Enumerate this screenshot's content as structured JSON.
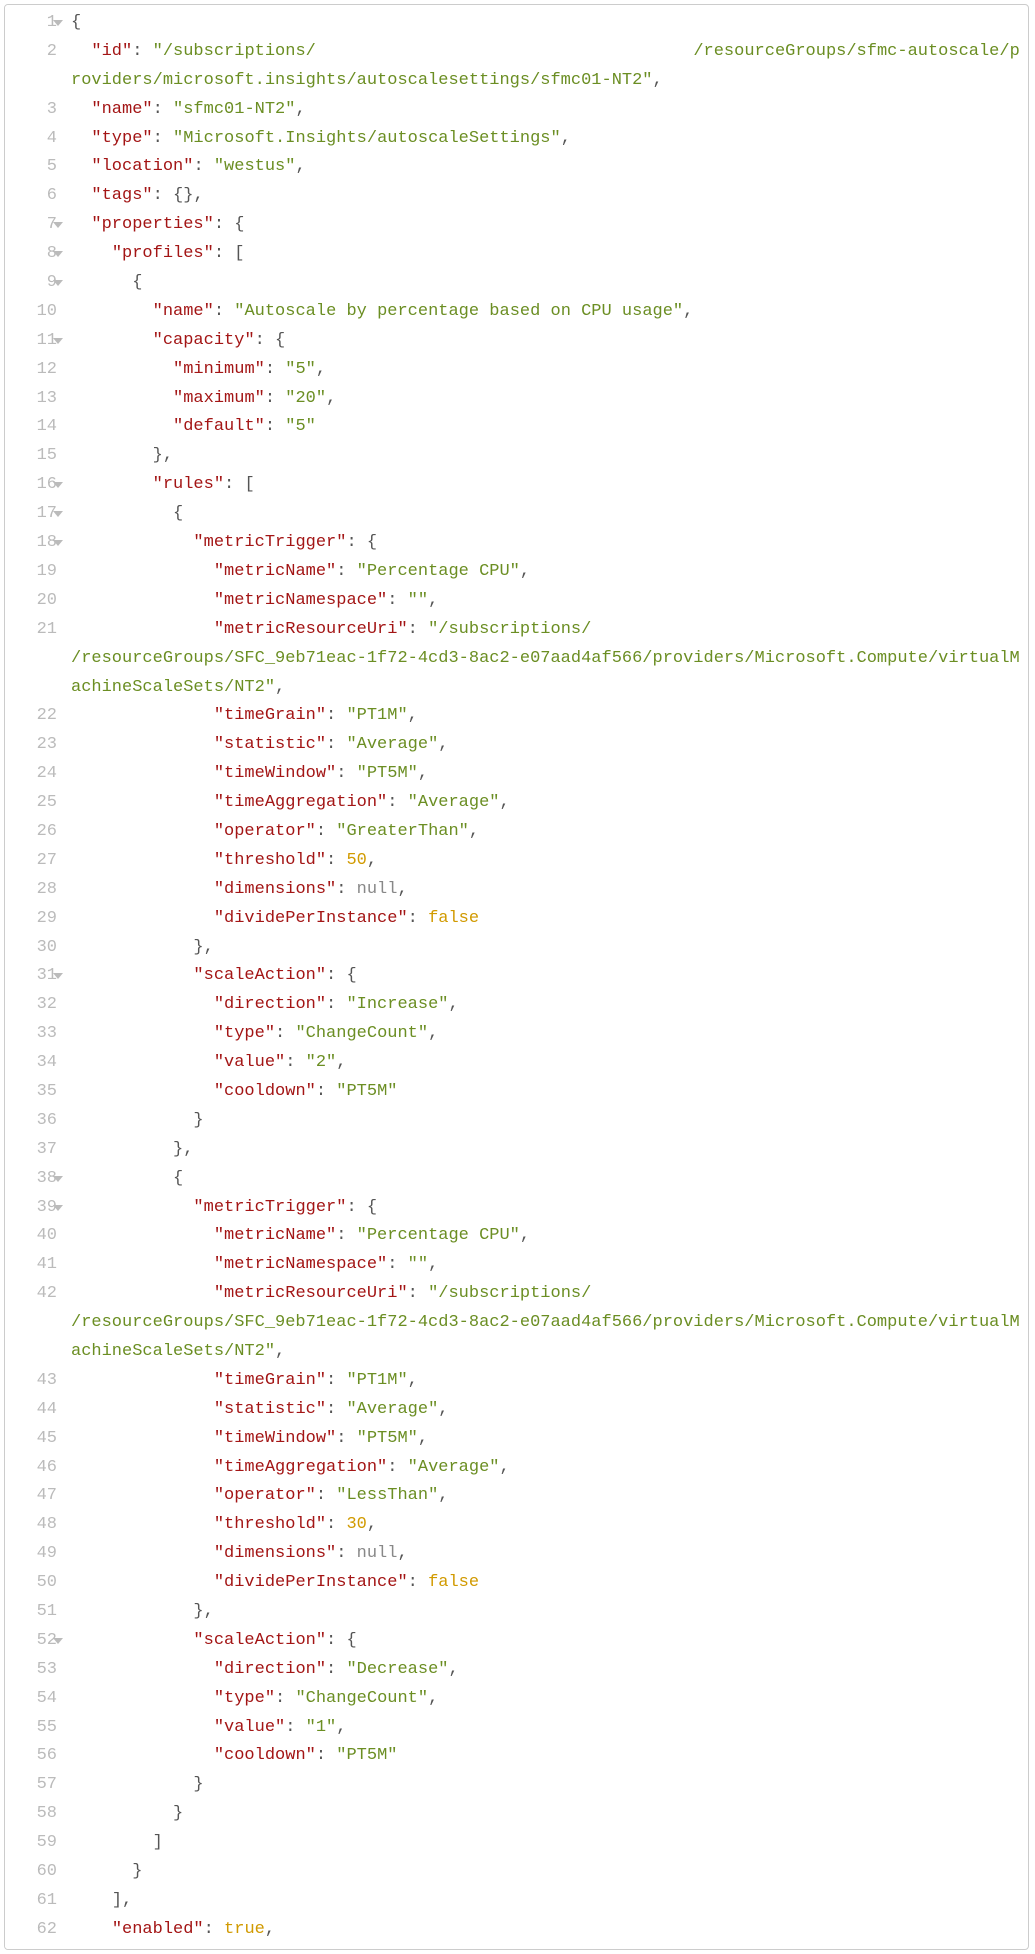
{
  "lines": [
    {
      "num": "1",
      "fold": true
    },
    {
      "num": "2",
      "fold": false
    },
    {
      "num": "3",
      "fold": false
    },
    {
      "num": "4",
      "fold": false
    },
    {
      "num": "5",
      "fold": false
    },
    {
      "num": "6",
      "fold": false
    },
    {
      "num": "7",
      "fold": true
    },
    {
      "num": "8",
      "fold": true
    },
    {
      "num": "9",
      "fold": true
    },
    {
      "num": "10",
      "fold": false
    },
    {
      "num": "11",
      "fold": true
    },
    {
      "num": "12",
      "fold": false
    },
    {
      "num": "13",
      "fold": false
    },
    {
      "num": "14",
      "fold": false
    },
    {
      "num": "15",
      "fold": false
    },
    {
      "num": "16",
      "fold": true
    },
    {
      "num": "17",
      "fold": true
    },
    {
      "num": "18",
      "fold": true
    },
    {
      "num": "19",
      "fold": false
    },
    {
      "num": "20",
      "fold": false
    },
    {
      "num": "21",
      "fold": false
    },
    {
      "num": "22",
      "fold": false
    },
    {
      "num": "23",
      "fold": false
    },
    {
      "num": "24",
      "fold": false
    },
    {
      "num": "25",
      "fold": false
    },
    {
      "num": "26",
      "fold": false
    },
    {
      "num": "27",
      "fold": false
    },
    {
      "num": "28",
      "fold": false
    },
    {
      "num": "29",
      "fold": false
    },
    {
      "num": "30",
      "fold": false
    },
    {
      "num": "31",
      "fold": true
    },
    {
      "num": "32",
      "fold": false
    },
    {
      "num": "33",
      "fold": false
    },
    {
      "num": "34",
      "fold": false
    },
    {
      "num": "35",
      "fold": false
    },
    {
      "num": "36",
      "fold": false
    },
    {
      "num": "37",
      "fold": false
    },
    {
      "num": "38",
      "fold": true
    },
    {
      "num": "39",
      "fold": true
    },
    {
      "num": "40",
      "fold": false
    },
    {
      "num": "41",
      "fold": false
    },
    {
      "num": "42",
      "fold": false
    },
    {
      "num": "43",
      "fold": false
    },
    {
      "num": "44",
      "fold": false
    },
    {
      "num": "45",
      "fold": false
    },
    {
      "num": "46",
      "fold": false
    },
    {
      "num": "47",
      "fold": false
    },
    {
      "num": "48",
      "fold": false
    },
    {
      "num": "49",
      "fold": false
    },
    {
      "num": "50",
      "fold": false
    },
    {
      "num": "51",
      "fold": false
    },
    {
      "num": "52",
      "fold": true
    },
    {
      "num": "53",
      "fold": false
    },
    {
      "num": "54",
      "fold": false
    },
    {
      "num": "55",
      "fold": false
    },
    {
      "num": "56",
      "fold": false
    },
    {
      "num": "57",
      "fold": false
    },
    {
      "num": "58",
      "fold": false
    },
    {
      "num": "59",
      "fold": false
    },
    {
      "num": "60",
      "fold": false
    },
    {
      "num": "61",
      "fold": false
    },
    {
      "num": "62",
      "fold": false
    }
  ],
  "json_content": {
    "id_key": "\"id\"",
    "id_val_1": "\"/subscriptions/",
    "id_val_2": "/resourceGroups/sfmc-autoscale/providers/microsoft.insights/autoscalesettings/sfmc01-NT2\"",
    "name_key": "\"name\"",
    "name_val": "\"sfmc01-NT2\"",
    "type_key": "\"type\"",
    "type_val": "\"Microsoft.Insights/autoscaleSettings\"",
    "location_key": "\"location\"",
    "location_val": "\"westus\"",
    "tags_key": "\"tags\"",
    "properties_key": "\"properties\"",
    "profiles_key": "\"profiles\"",
    "profile_name_key": "\"name\"",
    "profile_name_val": "\"Autoscale by percentage based on CPU usage\"",
    "capacity_key": "\"capacity\"",
    "minimum_key": "\"minimum\"",
    "minimum_val": "\"5\"",
    "maximum_key": "\"maximum\"",
    "maximum_val": "\"20\"",
    "default_key": "\"default\"",
    "default_val": "\"5\"",
    "rules_key": "\"rules\"",
    "metricTrigger_key": "\"metricTrigger\"",
    "metricName_key": "\"metricName\"",
    "metricName_val": "\"Percentage CPU\"",
    "metricNamespace_key": "\"metricNamespace\"",
    "metricNamespace_val": "\"\"",
    "metricResourceUri_key": "\"metricResourceUri\"",
    "metricResourceUri_val_1a": "\"/subscriptions/",
    "metricResourceUri_val_1b": "/resourceGroups/SFC_9eb71eac-1f72-4cd3-8ac2-e07aad4af566/providers/Microsoft.Compute/virtualMachineScaleSets/NT2\"",
    "timeGrain_key": "\"timeGrain\"",
    "timeGrain_val": "\"PT1M\"",
    "statistic_key": "\"statistic\"",
    "statistic_val": "\"Average\"",
    "timeWindow_key": "\"timeWindow\"",
    "timeWindow_val": "\"PT5M\"",
    "timeAggregation_key": "\"timeAggregation\"",
    "timeAggregation_val": "\"Average\"",
    "operator_key": "\"operator\"",
    "operator_val_gt": "\"GreaterThan\"",
    "threshold_key": "\"threshold\"",
    "threshold_val_50": "50",
    "dimensions_key": "\"dimensions\"",
    "dividePerInstance_key": "\"dividePerInstance\"",
    "scaleAction_key": "\"scaleAction\"",
    "direction_key": "\"direction\"",
    "direction_val_inc": "\"Increase\"",
    "action_type_key": "\"type\"",
    "action_type_val": "\"ChangeCount\"",
    "value_key": "\"value\"",
    "value_val_2": "\"2\"",
    "cooldown_key": "\"cooldown\"",
    "cooldown_val": "\"PT5M\"",
    "metricResourceUri_val_2a": "\"/subscriptions/",
    "metricResourceUri_val_2b": "/resourceGroups/SFC_9eb71eac-1f72-4cd3-8ac2-e07aad4af566/providers/Microsoft.Compute/virtualMachineScaleSets/NT2\"",
    "operator_val_lt": "\"LessThan\"",
    "threshold_val_30": "30",
    "direction_val_dec": "\"Decrease\"",
    "value_val_1": "\"1\"",
    "enabled_key": "\"enabled\"",
    "null_val": "null",
    "false_val": "false",
    "true_val": "true"
  }
}
